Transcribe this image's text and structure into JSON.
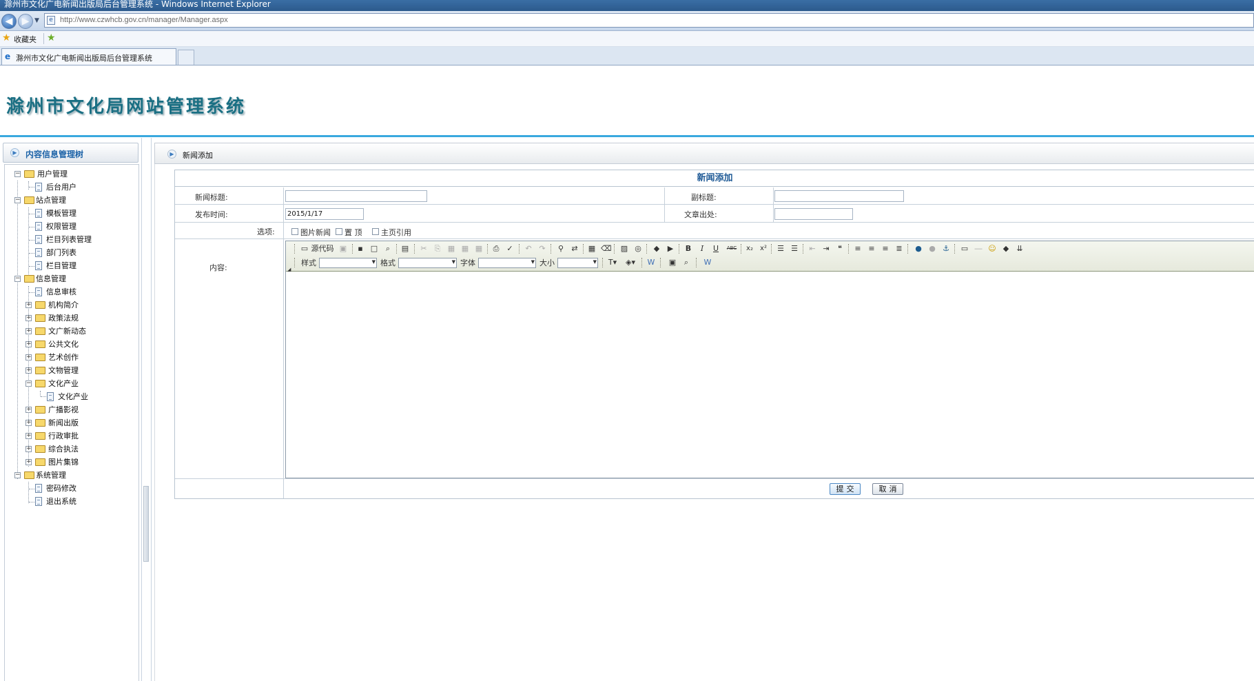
{
  "browser": {
    "title": "滁州市文化广电新闻出版局后台管理系统 - Windows Internet Explorer",
    "url": "http://www.czwhcb.gov.cn/manager/Manager.aspx",
    "favorites_label": "收藏夹",
    "tab_title": "滁州市文化广电新闻出版局后台管理系统"
  },
  "site": {
    "title": "滁州市文化局网站管理系统"
  },
  "sidebar": {
    "header": "内容信息管理树",
    "tree": {
      "user_mgmt": "用户管理",
      "backend_users": "后台用户",
      "site_mgmt": "站点管理",
      "template_mgmt": "模板管理",
      "permission_mgmt": "权限管理",
      "column_list_mgmt": "栏目列表管理",
      "department_list": "部门列表",
      "column_mgmt": "栏目管理",
      "info_mgmt": "信息管理",
      "info_review": "信息审核",
      "org_intro": "机构简介",
      "policy_law": "政策法规",
      "culture_news": "文广新动态",
      "public_culture": "公共文化",
      "art_creation": "艺术创作",
      "heritage_mgmt": "文物管理",
      "culture_industry": "文化产业",
      "culture_industry_sub": "文化产业",
      "radio_film": "广播影视",
      "news_publishing": "新闻出版",
      "admin_approval": "行政审批",
      "law_enforcement": "综合执法",
      "photo_gallery": "图片集锦",
      "system_mgmt": "系统管理",
      "change_password": "密码修改",
      "logout": "退出系统"
    }
  },
  "main": {
    "header": "新闻添加",
    "form": {
      "title": "新闻添加",
      "news_title_label": "新闻标题:",
      "news_title_value": "",
      "subtitle_label": "副标题:",
      "subtitle_value": "",
      "publish_time_label": "发布时间:",
      "publish_time_value": "2015/1/17",
      "source_label": "文章出处:",
      "source_value": "",
      "options_label": "选项:",
      "option_image_news": "图片新闻",
      "option_pin_top": "置 顶",
      "option_home_ref": "主页引用",
      "content_label": "内容:",
      "submit_label": "提交",
      "cancel_label": "取消"
    },
    "editor": {
      "source_code": "源代码",
      "style_label": "样式",
      "format_label": "格式",
      "font_label": "字体",
      "size_label": "大小",
      "bold": "B",
      "italic": "I",
      "underline": "U",
      "strike": "ABC",
      "subscript": "x₂",
      "superscript": "x²"
    }
  },
  "colors": {
    "title_teal": "#1a6f83",
    "header_rule": "#39a9de",
    "form_title": "#1f5a96"
  }
}
